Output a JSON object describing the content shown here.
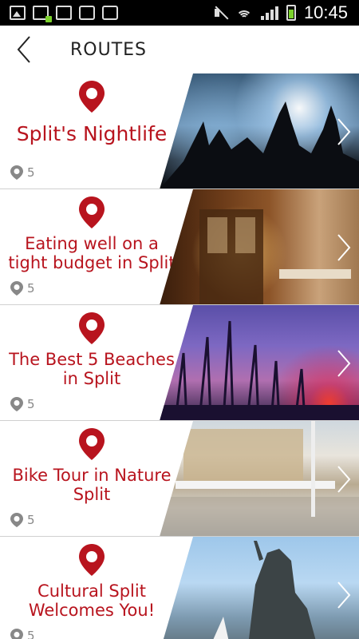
{
  "status_bar": {
    "time": "10:45",
    "icons": [
      "image-icon",
      "download-icon",
      "file-icon",
      "bag-icon",
      "bag-icon",
      "mute-icon",
      "wifi-icon",
      "signal-icon",
      "battery-icon"
    ]
  },
  "header": {
    "title": "ROUTES",
    "back_icon": "chevron-left-icon"
  },
  "colors": {
    "accent": "#b8141e",
    "muted": "#888888",
    "divider": "#d0d0d0"
  },
  "routes": [
    {
      "title": "Split's Nightlife",
      "count": "5",
      "photo": "concert-crowd"
    },
    {
      "title": "Eating well on a tight budget in Split",
      "count": "5",
      "photo": "restaurant-interior"
    },
    {
      "title": "The Best 5 Beaches in Split",
      "count": "5",
      "photo": "beach-sunset"
    },
    {
      "title": "Bike Tour in Nature Split",
      "count": "5",
      "photo": "riva-promenade"
    },
    {
      "title": "Cultural Split Welcomes You!",
      "count": "5",
      "photo": "gregory-statue"
    }
  ]
}
